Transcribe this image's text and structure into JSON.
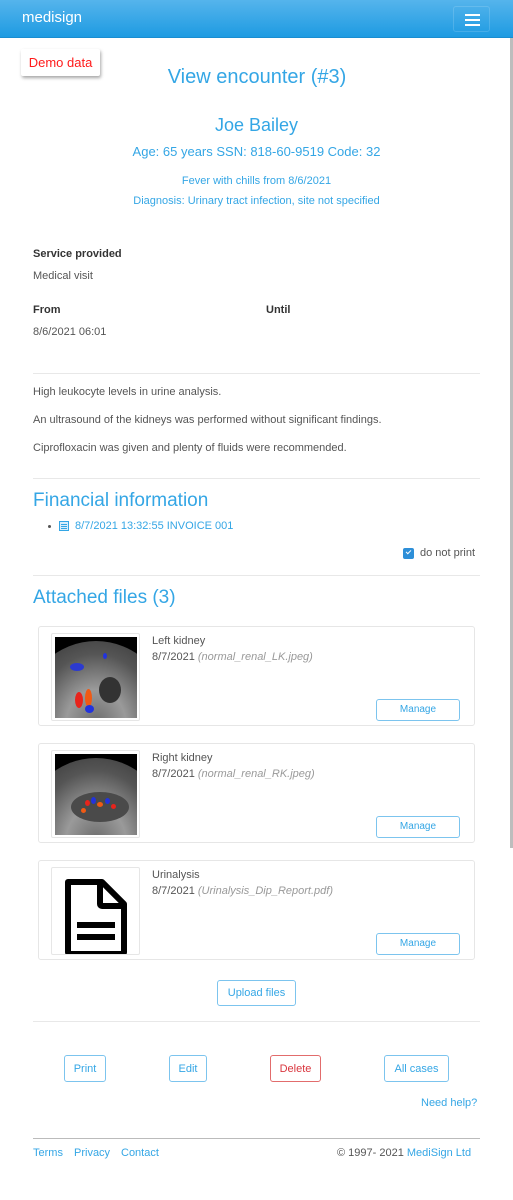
{
  "navbar": {
    "brand": "medisign",
    "menu_icon": "hamburger-menu-icon"
  },
  "demo_badge": "Demo data",
  "page_title": "View encounter (#3)",
  "patient": {
    "name": "Joe Bailey",
    "info": "Age: 65 years SSN: 818-60-9519 Code: 32",
    "complaint": "Fever with chills from 8/6/2021",
    "diagnosis": "Diagnosis: Urinary tract infection, site not specified"
  },
  "service": {
    "label": "Service provided",
    "value": "Medical visit",
    "from_label": "From",
    "from_value": "8/6/2021 06:01",
    "until_label": "Until",
    "until_value": ""
  },
  "notes": [
    "High leukocyte levels in urine analysis.",
    "An ultrasound of the kidneys was performed without significant findings.",
    "Ciprofloxacin was given and plenty of fluids were recommended."
  ],
  "financial": {
    "title": "Financial information",
    "invoices": [
      {
        "label": "8/7/2021 13:32:55 INVOICE 001",
        "icon": "invoice-icon"
      }
    ],
    "do_not_print_label": "do not print",
    "do_not_print_checked": true
  },
  "attachments": {
    "title": "Attached files (3)",
    "files": [
      {
        "title": "Left kidney",
        "date": "8/7/2021",
        "filename": "(normal_renal_LK.jpeg)",
        "thumb": "ultrasound-image",
        "manage_label": "Manage"
      },
      {
        "title": "Right kidney",
        "date": "8/7/2021",
        "filename": "(normal_renal_RK.jpeg)",
        "thumb": "ultrasound-image",
        "manage_label": "Manage"
      },
      {
        "title": "Urinalysis",
        "date": "8/7/2021",
        "filename": "(Urinalysis_Dip_Report.pdf)",
        "thumb": "document-icon",
        "manage_label": "Manage"
      }
    ],
    "upload_label": "Upload files"
  },
  "actions": {
    "print": "Print",
    "edit": "Edit",
    "delete": "Delete",
    "all_cases": "All cases",
    "help": "Need help?"
  },
  "footer": {
    "links": [
      "Terms",
      "Privacy",
      "Contact"
    ],
    "copyright": "© 1997- 2021 ",
    "company": "MediSign Ltd"
  },
  "colors": {
    "accent": "#34a6e5",
    "navbar": "#1e9be2",
    "danger": "#d9363e",
    "demo": "#ff1a1a"
  }
}
